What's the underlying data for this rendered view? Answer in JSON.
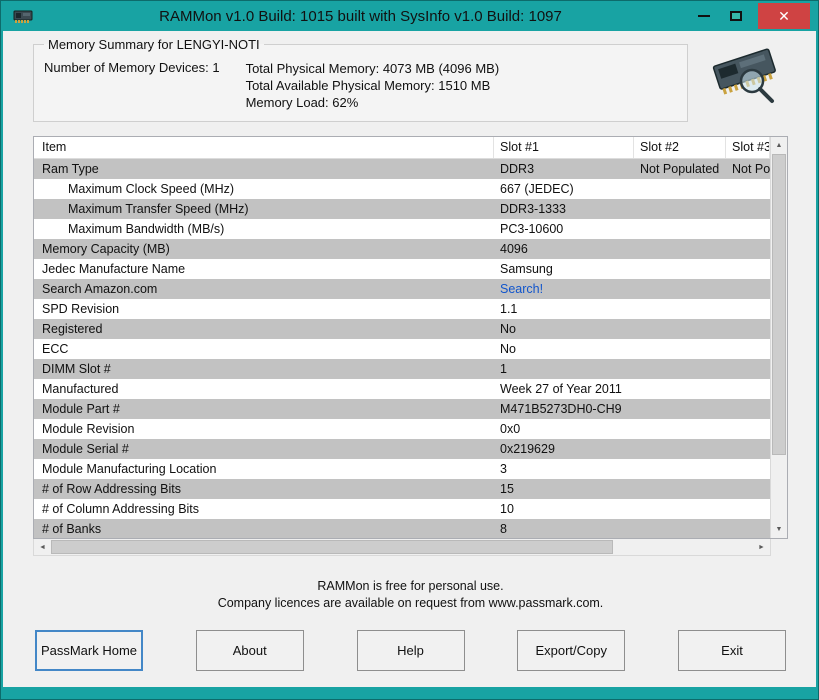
{
  "window": {
    "title": "RAMMon v1.0 Build: 1015 built with SysInfo v1.0 Build: 1097",
    "controls": {
      "close_glyph": "✕"
    }
  },
  "accent_colors": {
    "titlebar_teal": "#18a3a3",
    "close_red": "#cf4343",
    "row_gray": "#c2c2c2",
    "link_blue": "#1155cc"
  },
  "icons": {
    "up": "▲",
    "down": "▼",
    "left": "◄",
    "right": "►",
    "app": "ram-chip-icon",
    "summary": "ram-chip-magnifier-icon"
  },
  "summary": {
    "legend": "Memory Summary for LENGYI-NOTI",
    "devices_label": "Number of Memory Devices: 1",
    "lines": [
      "Total Physical Memory: 4073 MB (4096 MB)",
      "Total Available Physical Memory: 1510 MB",
      "Memory Load: 62%"
    ]
  },
  "table": {
    "columns": [
      "Item",
      "Slot #1",
      "Slot #2",
      "Slot #3"
    ],
    "rows": [
      {
        "item": "Ram Type",
        "indent": false,
        "slot1": "DDR3",
        "slot2": "Not Populated",
        "slot3": "Not Populated"
      },
      {
        "item": "Maximum Clock Speed (MHz)",
        "indent": true,
        "slot1": "667 (JEDEC)",
        "slot2": "",
        "slot3": ""
      },
      {
        "item": "Maximum Transfer Speed (MHz)",
        "indent": true,
        "slot1": "DDR3-1333",
        "slot2": "",
        "slot3": ""
      },
      {
        "item": "Maximum Bandwidth (MB/s)",
        "indent": true,
        "slot1": "PC3-10600",
        "slot2": "",
        "slot3": ""
      },
      {
        "item": "Memory Capacity (MB)",
        "indent": false,
        "slot1": "4096",
        "slot2": "",
        "slot3": ""
      },
      {
        "item": "Jedec Manufacture Name",
        "indent": false,
        "slot1": "Samsung",
        "slot2": "",
        "slot3": ""
      },
      {
        "item": "Search Amazon.com",
        "indent": false,
        "slot1": "Search!",
        "link": true,
        "slot2": "",
        "slot3": ""
      },
      {
        "item": "SPD Revision",
        "indent": false,
        "slot1": "1.1",
        "slot2": "",
        "slot3": ""
      },
      {
        "item": "Registered",
        "indent": false,
        "slot1": "No",
        "slot2": "",
        "slot3": ""
      },
      {
        "item": "ECC",
        "indent": false,
        "slot1": "No",
        "slot2": "",
        "slot3": ""
      },
      {
        "item": "DIMM Slot #",
        "indent": false,
        "slot1": "1",
        "slot2": "",
        "slot3": ""
      },
      {
        "item": "Manufactured",
        "indent": false,
        "slot1": "Week 27 of Year 2011",
        "slot2": "",
        "slot3": ""
      },
      {
        "item": "Module Part #",
        "indent": false,
        "slot1": "M471B5273DH0-CH9",
        "slot2": "",
        "slot3": ""
      },
      {
        "item": "Module Revision",
        "indent": false,
        "slot1": "0x0",
        "slot2": "",
        "slot3": ""
      },
      {
        "item": "Module Serial #",
        "indent": false,
        "slot1": "0x219629",
        "slot2": "",
        "slot3": ""
      },
      {
        "item": "Module Manufacturing Location",
        "indent": false,
        "slot1": "3",
        "slot2": "",
        "slot3": ""
      },
      {
        "item": "# of Row Addressing Bits",
        "indent": false,
        "slot1": "15",
        "slot2": "",
        "slot3": ""
      },
      {
        "item": "# of Column Addressing Bits",
        "indent": false,
        "slot1": "10",
        "slot2": "",
        "slot3": ""
      },
      {
        "item": "# of Banks",
        "indent": false,
        "slot1": "8",
        "slot2": "",
        "slot3": ""
      }
    ]
  },
  "footer": {
    "line1": "RAMMon is free for personal use.",
    "line2": "Company licences are available on request from www.passmark.com."
  },
  "buttons": [
    "PassMark Home",
    "About",
    "Help",
    "Export/Copy",
    "Exit"
  ]
}
